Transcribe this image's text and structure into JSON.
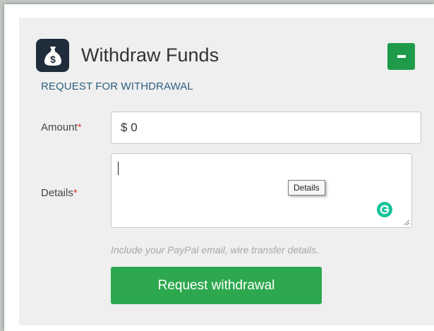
{
  "widget": {
    "title": "Withdraw Funds",
    "icon": "money-bag-icon",
    "collapse_icon": "minus-icon",
    "subtitle": "REQUEST FOR WITHDRAWAL"
  },
  "form": {
    "amount_label": "Amount",
    "details_label": "Details",
    "required_mark": "*",
    "currency_symbol": "$",
    "amount_value": "0",
    "details_value": "",
    "details_tooltip": "Details",
    "hint": "Include your PayPal email, wire transfer details.",
    "submit_label": "Request withdrawal"
  },
  "colors": {
    "panel_bg": "#efefef",
    "icon_bg": "#1f2d3a",
    "subtitle": "#2c5f7e",
    "button_green": "#2ea84f",
    "collapse_green": "#1e9b4a",
    "required_red": "#d9453b",
    "grammarly_green": "#15c39a"
  }
}
